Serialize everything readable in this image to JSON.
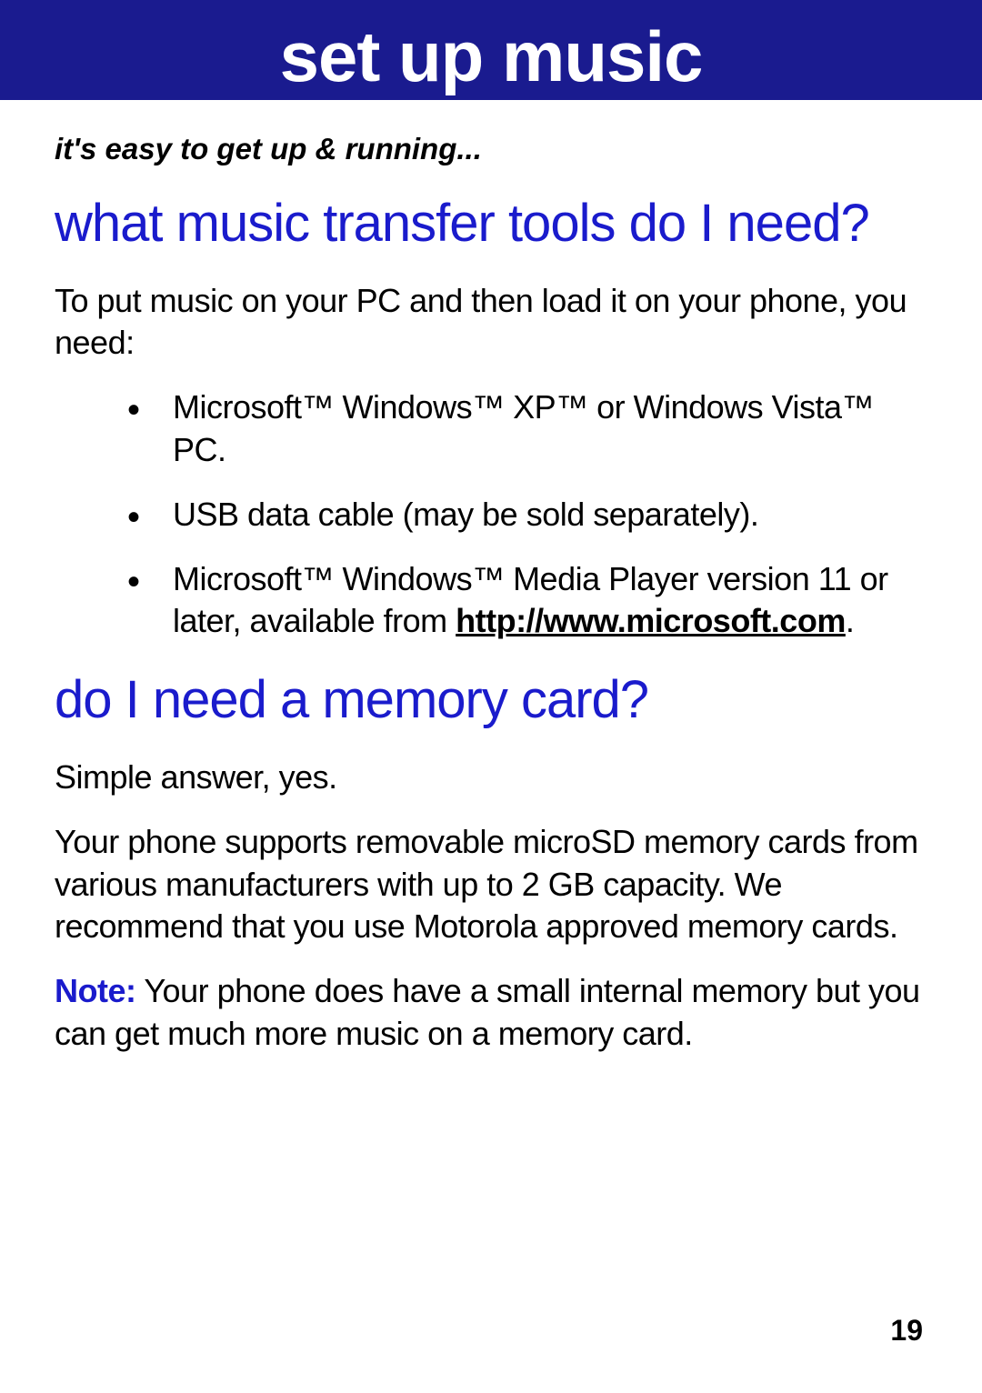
{
  "banner": {
    "title": "set up music"
  },
  "tagline": "it's easy to get up & running...",
  "section1": {
    "heading": "what music transfer tools do I need?",
    "intro": "To put music on your PC and then load it on your phone, you need:",
    "bullets": [
      "Microsoft™ Windows™ XP™ or Windows Vista™ PC.",
      "USB data cable (may be sold separately)."
    ],
    "bullet3_prefix": "Microsoft™ Windows™ Media Player version 11 or later, available from ",
    "bullet3_link": "http://www.microsoft.com",
    "bullet3_suffix": "."
  },
  "section2": {
    "heading": "do I need a memory card?",
    "para1": "Simple answer, yes.",
    "para2": "Your phone supports removable microSD memory cards from various manufacturers with up to 2 GB capacity. We recommend that you use Motorola approved memory cards.",
    "note_label": "Note:",
    "note_text": " Your phone does have a small internal memory but you can get much more music on a memory card."
  },
  "page_number": "19"
}
